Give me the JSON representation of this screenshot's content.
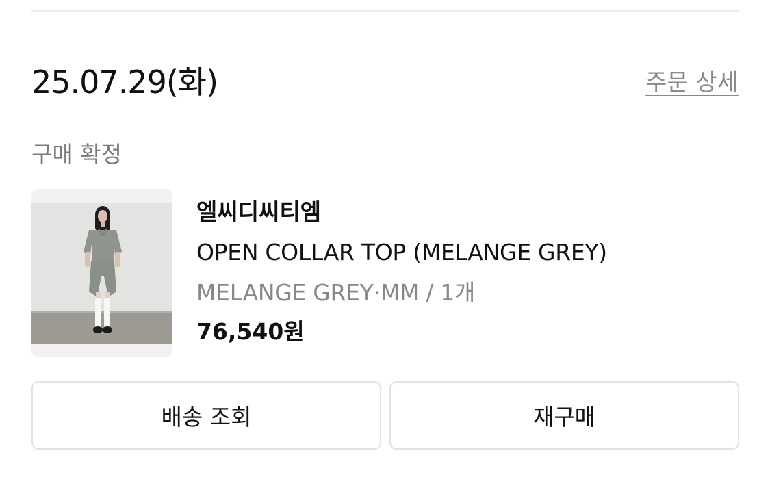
{
  "order": {
    "date": "25.07.29(화)",
    "detail_link": "주문 상세",
    "status": "구매 확정"
  },
  "product": {
    "brand": "엘씨디씨티엠",
    "name": "OPEN COLLAR TOP (MELANGE GREY)",
    "option": "MELANGE GREY·MM / 1개",
    "price": "76,540원"
  },
  "actions": {
    "track_label": "배송 조회",
    "rebuy_label": "재구매"
  },
  "colors": {
    "primary_text": "#111111",
    "secondary_text": "#888888",
    "border": "#e3e3e3",
    "thumbnail_bg": "#f1f1f1"
  }
}
